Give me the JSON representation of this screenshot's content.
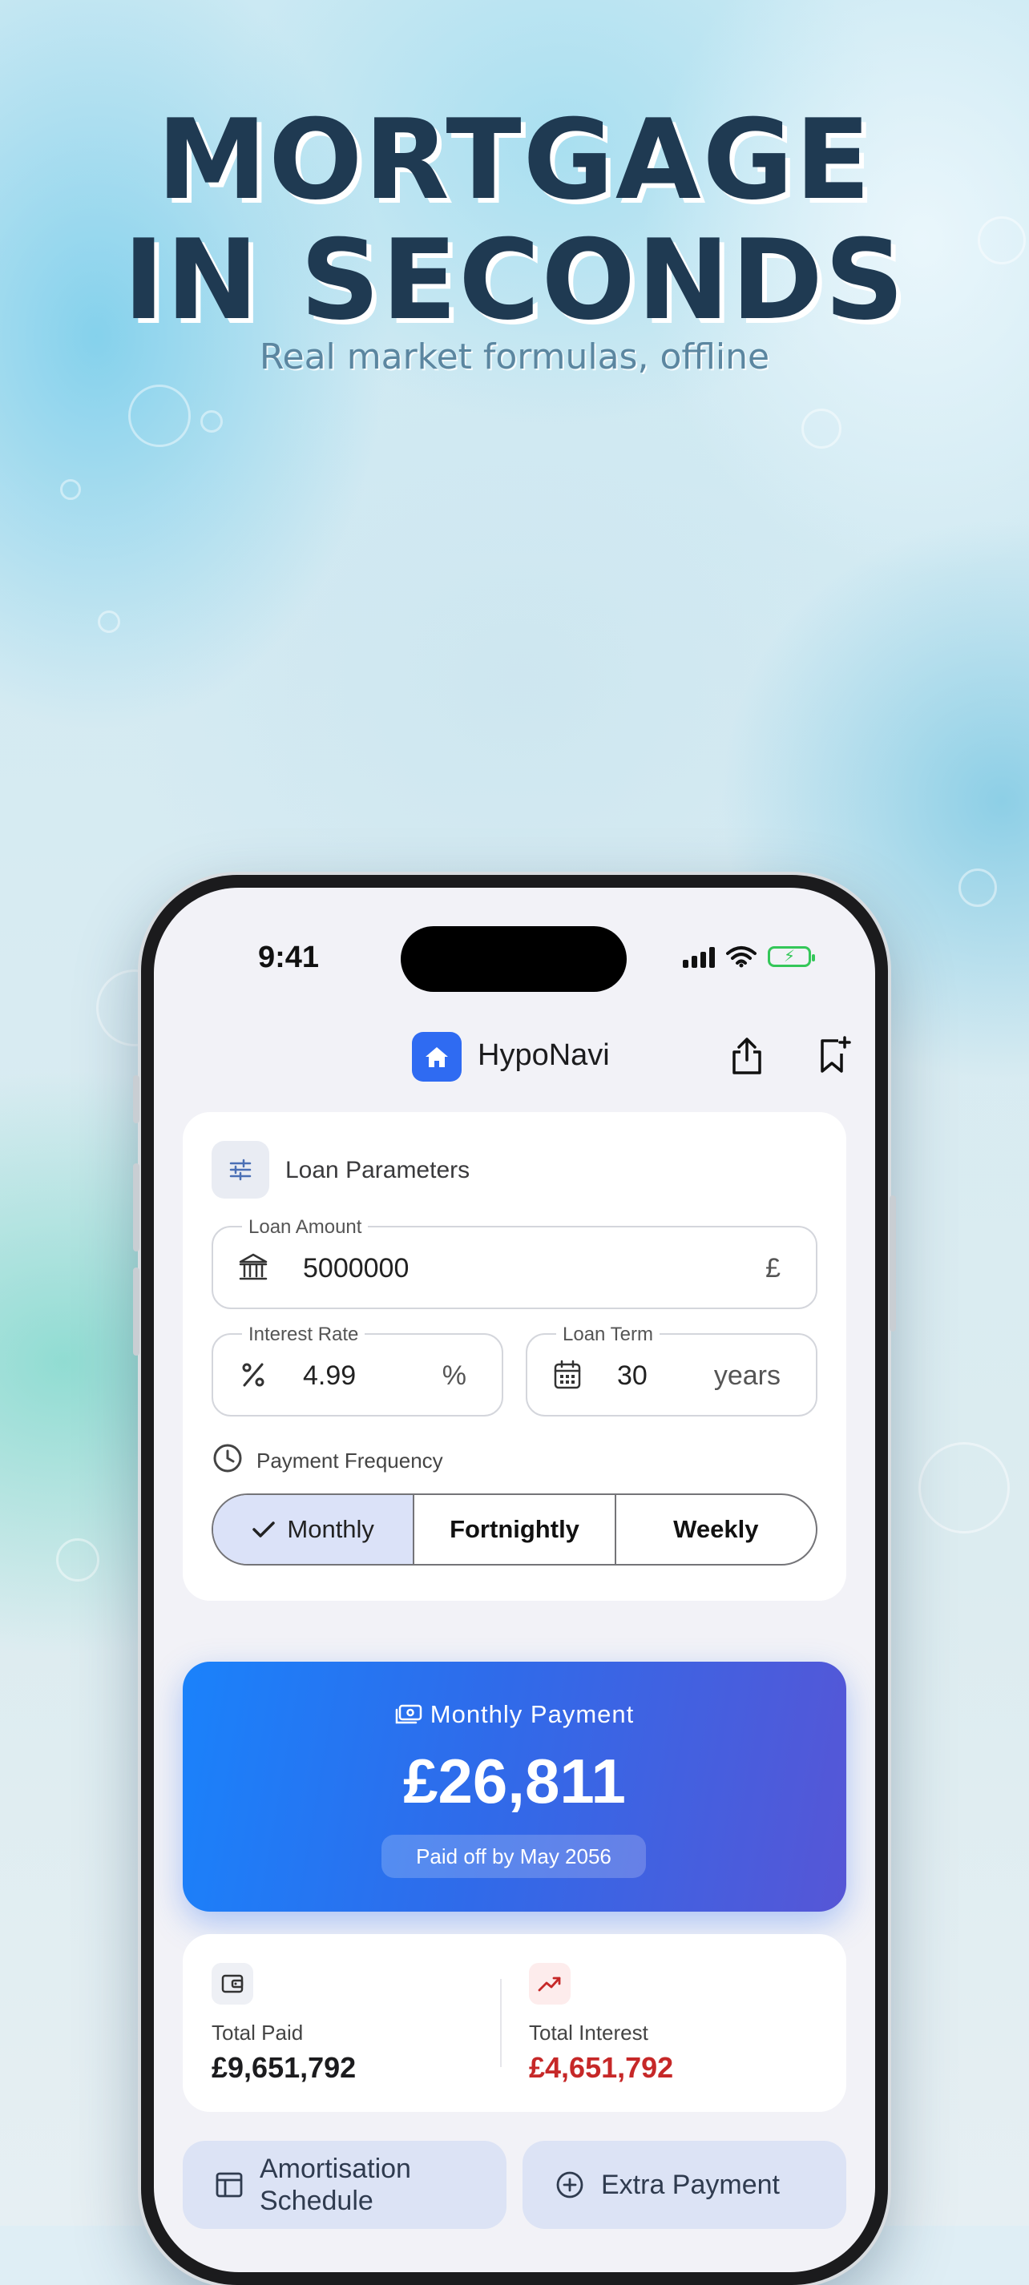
{
  "hero": {
    "title_line1": "MORTGAGE",
    "title_line2": "IN SECONDS",
    "subtitle": "Real market formulas, offline"
  },
  "status_bar": {
    "time": "9:41"
  },
  "app": {
    "title": "HypoNavi"
  },
  "params": {
    "title": "Loan Parameters",
    "loan_amount": {
      "label": "Loan Amount",
      "value": "5000000",
      "suffix": "£"
    },
    "interest_rate": {
      "label": "Interest Rate",
      "value": "4.99",
      "suffix": "%"
    },
    "loan_term": {
      "label": "Loan Term",
      "value": "30",
      "suffix": "years"
    },
    "frequency_label": "Payment Frequency",
    "frequencies": [
      "Monthly",
      "Fortnightly",
      "Weekly"
    ],
    "selected_frequency": "Monthly"
  },
  "payment": {
    "label": "Monthly Payment",
    "value": "£26,811",
    "paid_off": "Paid off by May 2056"
  },
  "totals": {
    "total_paid_label": "Total Paid",
    "total_paid_value": "£9,651,792",
    "total_interest_label": "Total Interest",
    "total_interest_value": "£4,651,792"
  },
  "actions": {
    "amortisation_line1": "Amortisation",
    "amortisation_line2": "Schedule",
    "extra_payment": "Extra Payment"
  },
  "colors": {
    "headline": "#1f3a52",
    "accent": "#2f6bf2",
    "interest_red": "#c62828",
    "payment_gradient_start": "#1a82fb",
    "payment_gradient_end": "#5656d6"
  },
  "icons": {
    "app_logo": "house-icon",
    "share": "share-icon",
    "bookmark": "bookmark-add-icon",
    "params": "sliders-icon",
    "loan_amount": "bank-icon",
    "interest_rate": "percent-icon",
    "loan_term": "calendar-icon",
    "frequency": "clock-icon",
    "selected": "checkmark-icon",
    "payment": "cash-icon",
    "total_paid": "wallet-icon",
    "total_interest": "trending-up-icon",
    "amortisation": "table-icon",
    "extra_payment": "plus-circle-icon"
  }
}
